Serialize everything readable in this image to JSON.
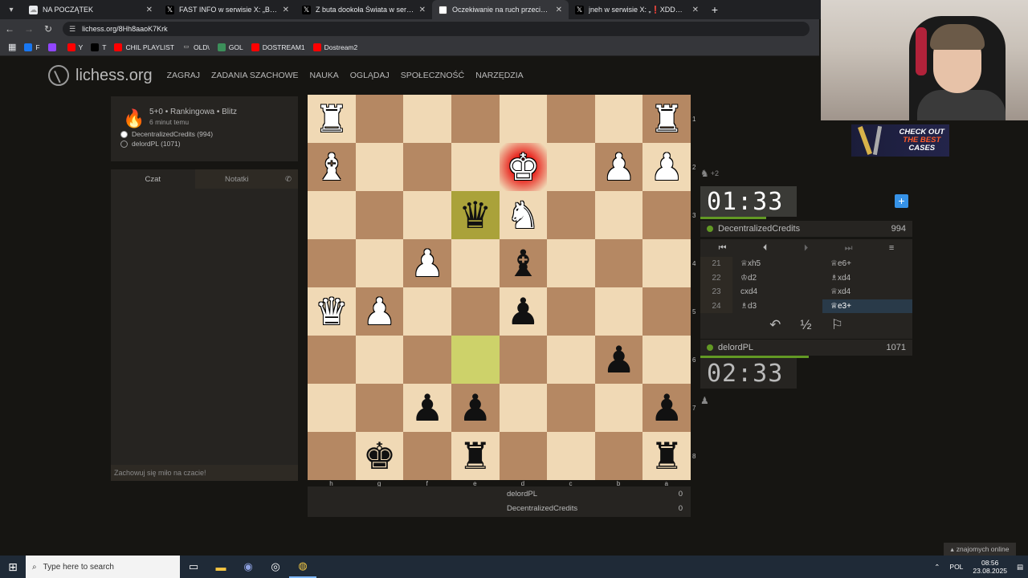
{
  "browser": {
    "tabs": [
      {
        "title": "NA POCZĄTEK",
        "active": false,
        "icon": "fire-fav",
        "color": "#e8eaed"
      },
      {
        "title": "FAST INFO w serwisie X: „BESTI…",
        "active": false,
        "icon": "x-fav",
        "color": "#000000"
      },
      {
        "title": "Z buta dookoła Świata w serwis…",
        "active": false,
        "icon": "x-fav",
        "color": "#000000"
      },
      {
        "title": "Oczekiwanie na ruch przeciwni…",
        "active": true,
        "icon": "lichess-fav",
        "color": "#ffffff"
      },
      {
        "title": "jneh w serwisie X: „❗XDDDDD…",
        "active": false,
        "icon": "x-fav",
        "color": "#000000"
      }
    ],
    "url": "lichess.org/8Hh8aaoK7Krk",
    "bookmarks": [
      {
        "label": "F",
        "color": "#1877f2"
      },
      {
        "label": "",
        "color": "#9146ff"
      },
      {
        "label": "Y",
        "color": "#ff0000"
      },
      {
        "label": "T",
        "color": "#000000"
      },
      {
        "label": "CHIL PLAYLIST",
        "color": "#ff0000"
      },
      {
        "label": "OLD\\",
        "color": "#35363a"
      },
      {
        "label": "GOL",
        "color": "#3c8f5a"
      },
      {
        "label": "DOSTREAM1",
        "color": "#ff0000"
      },
      {
        "label": "Dostream2",
        "color": "#ff0000"
      }
    ]
  },
  "site": {
    "logo": "lichess.org",
    "nav": [
      "ZAGRAJ",
      "ZADANIA SZACHOWE",
      "NAUKA",
      "OGLĄDAJ",
      "SPOŁECZNOŚĆ",
      "NARZĘDZIA"
    ]
  },
  "game_info": {
    "title": "5+0 • Rankingowa • Blitz",
    "subtitle": "6 minut temu",
    "players": [
      {
        "name": "DecentralizedCredits (994)",
        "color": "#ffffff"
      },
      {
        "name": "delordPL (1071)",
        "color": "#262421"
      }
    ]
  },
  "chat": {
    "tab_chat": "Czat",
    "tab_notes": "Notatki",
    "placeholder": "Zachowuj się miło na czacie!"
  },
  "board": {
    "rows": [
      [
        "wR",
        "",
        "",
        "",
        "",
        "",
        "",
        "wR"
      ],
      [
        "wB",
        "",
        "",
        "",
        "wK!",
        "",
        "wP",
        "wP"
      ],
      [
        "",
        "",
        "",
        "bQ*",
        "wN",
        "",
        "",
        ""
      ],
      [
        "",
        "",
        "wP",
        "",
        "bB",
        "",
        "",
        ""
      ],
      [
        "wQ",
        "wP",
        "",
        "",
        "bP",
        "",
        "",
        ""
      ],
      [
        "",
        "",
        "",
        "*",
        "",
        "",
        "bP",
        ""
      ],
      [
        "",
        "",
        "bP",
        "bP",
        "",
        "",
        "",
        "bP"
      ],
      [
        "",
        "bK",
        "",
        "bR",
        "",
        "",
        "",
        "bR"
      ]
    ],
    "ranks": [
      "1",
      "2",
      "3",
      "4",
      "5",
      "6",
      "7",
      "8"
    ],
    "files": [
      "h",
      "g",
      "f",
      "e",
      "d",
      "c",
      "b",
      "a"
    ]
  },
  "score_table": [
    {
      "name": "delordPL",
      "score": "0"
    },
    {
      "name": "DecentralizedCredits",
      "score": "0"
    }
  ],
  "top_player": {
    "name": "DecentralizedCredits",
    "rating": "994",
    "clock": "01:33",
    "material": "+2",
    "clock_fraction": 0.31
  },
  "bottom_player": {
    "name": "delordPL",
    "rating": "1071",
    "clock": "02:33",
    "clock_fraction": 0.51
  },
  "moves": [
    {
      "num": "21",
      "white": "♕xh5",
      "black": "♕e6+"
    },
    {
      "num": "22",
      "white": "♔d2",
      "black": "♗xd4"
    },
    {
      "num": "23",
      "white": "cxd4",
      "black": "♕xd4"
    },
    {
      "num": "24",
      "white": "♗d3",
      "black": "♕e3+"
    }
  ],
  "move_controls": [
    "⏮",
    "⏴",
    "⏵",
    "⏭",
    "≡"
  ],
  "actions": [
    "↶",
    "½",
    "⚐"
  ],
  "overlay": {
    "promo_line1": "CHECK OUT",
    "promo_line2": "THE BEST",
    "promo_line3": "CASES"
  },
  "friends_online": "znajomych online",
  "taskbar": {
    "search_placeholder": "Type here to search",
    "lang": "POL",
    "time": "08:56",
    "date": "23.08.2025"
  }
}
